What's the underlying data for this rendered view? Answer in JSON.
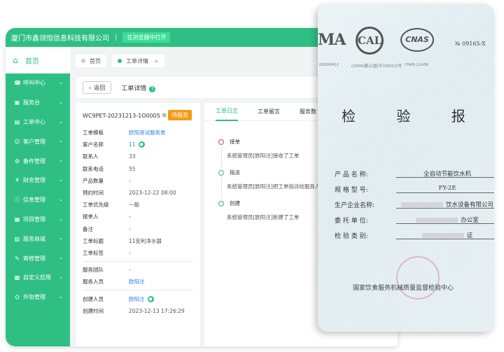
{
  "topbar": {
    "company": "厦门市鑫领恒信息科技有限公司",
    "separator": "|",
    "open_new_window": "在浏览器中打开"
  },
  "sidebar": {
    "home": "首页",
    "items": [
      {
        "label": "呼叫中心",
        "icon": "phone-icon"
      },
      {
        "label": "服务台",
        "icon": "desk-icon"
      },
      {
        "label": "工单中心",
        "icon": "ticket-icon"
      },
      {
        "label": "客户管理",
        "icon": "customer-icon"
      },
      {
        "label": "备件管理",
        "icon": "parts-icon"
      },
      {
        "label": "财务管理",
        "icon": "finance-icon"
      },
      {
        "label": "信息管理",
        "icon": "info-icon"
      },
      {
        "label": "项目管理",
        "icon": "project-icon"
      },
      {
        "label": "服务商城",
        "icon": "shop-icon"
      },
      {
        "label": "寄修管理",
        "icon": "repair-icon"
      },
      {
        "label": "自定义应用",
        "icon": "custom-app-icon"
      },
      {
        "label": "外协管理",
        "icon": "outsource-icon"
      }
    ]
  },
  "tabs": [
    {
      "label": "首页"
    },
    {
      "label": "工单详情",
      "close": "×"
    }
  ],
  "header": {
    "back": "返回",
    "title": "工单详情",
    "help": "?"
  },
  "detail": {
    "order_no": "WC9PET-20231213-1O0005",
    "status": "待服务",
    "fields": [
      {
        "key": "工单模板",
        "value": "欧阳测试服务类",
        "link": true
      },
      {
        "key": "客户名称",
        "value": "11",
        "link": true,
        "icon": true
      },
      {
        "key": "联系人",
        "value": "33"
      },
      {
        "key": "联系电话",
        "value": "55"
      },
      {
        "key": "产品数量",
        "value": "-"
      },
      {
        "key": "预约时间",
        "value": "2023-12-22 08:00"
      },
      {
        "key": "工单优先级",
        "value": "一般"
      },
      {
        "key": "报单人",
        "value": "-"
      },
      {
        "key": "备注",
        "value": "-"
      },
      {
        "key": "工单标题",
        "value": "11安利净水器"
      },
      {
        "key": "工单标签",
        "value": "-"
      }
    ],
    "fields2": [
      {
        "key": "服务团队",
        "value": "-"
      },
      {
        "key": "服务人员",
        "value": "欧阳注",
        "link": true
      }
    ],
    "fields3": [
      {
        "key": "创建人员",
        "value": "欧阳注",
        "link": true,
        "icon": true
      },
      {
        "key": "创建时间",
        "value": "2023-12-13 17:26:29"
      }
    ]
  },
  "log": {
    "tabs": [
      {
        "label": "工单日志",
        "active": true
      },
      {
        "label": "工单留言"
      },
      {
        "label": "服务数"
      }
    ],
    "entries": [
      {
        "title": "接单",
        "desc": "系统管理员[欧阳注]接收了工单",
        "color": "#e8425a"
      },
      {
        "title": "指派",
        "desc": "系统管理员[欧阳注]把工单指派给服务人",
        "color": "#2fbf85"
      },
      {
        "title": "创建",
        "desc": "系统管理员[欧阳注]新建了工单",
        "color": "#2fbf85"
      }
    ]
  },
  "certificate": {
    "logo_ma": "MA",
    "logo_cal": "CAL",
    "logo_cnas": "CNAS",
    "number": "№ 09165-X",
    "codes": [
      "00000412",
      "(2009)量认(国)字(Z0012)号",
      "CNAS L1436"
    ],
    "title": "检 验 报 告",
    "fields": [
      {
        "label": "产 品 名 称:",
        "value": "全自动节能饮水机"
      },
      {
        "label": "规 格 型 号:",
        "value": "FY-2E"
      },
      {
        "label": "生产企业名称:",
        "value": "饮水设备有限公司",
        "redacted": true
      },
      {
        "label": "委 托 单 位:",
        "value": "办公室",
        "redacted": true
      },
      {
        "label": "检 验 类 别:",
        "value": "证",
        "redacted": true
      }
    ],
    "org": "国家饮食服务机械质量监督检验中心"
  }
}
